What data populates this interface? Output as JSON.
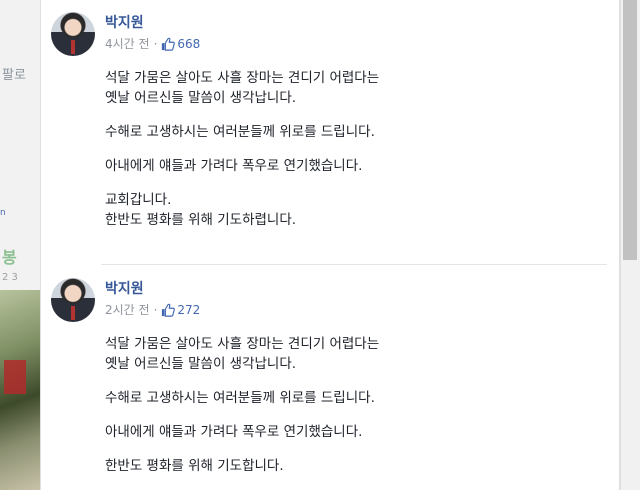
{
  "background": {
    "left_text": "팔로",
    "left_text2": "봉",
    "left_text3": "2 3",
    "left_dot": "n"
  },
  "posts": [
    {
      "author": "박지원",
      "time": "4시간 전",
      "separator": "·",
      "likes": "668",
      "paragraphs": [
        [
          "석달 가뭄은 살아도 사흘 장마는 견디기 어렵다는",
          "옛날 어르신들 말씀이 생각납니다."
        ],
        [
          "수해로 고생하시는 여러분들께 위로를 드립니다."
        ],
        [
          "아내에게 얘들과 가려다 폭우로 연기했습니다."
        ],
        [
          "교회갑니다.",
          "한반도 평화를 위해 기도하렵니다."
        ]
      ]
    },
    {
      "author": "박지원",
      "time": "2시간 전",
      "separator": "·",
      "likes": "272",
      "paragraphs": [
        [
          "석달 가뭄은 살아도 사흘 장마는 견디기 어렵다는",
          "옛날 어르신들 말씀이 생각납니다."
        ],
        [
          "수해로 고생하시는 여러분들께 위로를 드립니다."
        ],
        [
          "아내에게 얘들과 가려다 폭우로 연기했습니다."
        ],
        [
          "한반도 평화를 위해 기도합니다."
        ]
      ]
    }
  ],
  "colors": {
    "author": "#365899",
    "like": "#4267b2",
    "meta": "#90949c",
    "text": "#1d2129"
  },
  "icons": {
    "avatar": "profile-photo",
    "like": "thumbs-up-icon"
  }
}
